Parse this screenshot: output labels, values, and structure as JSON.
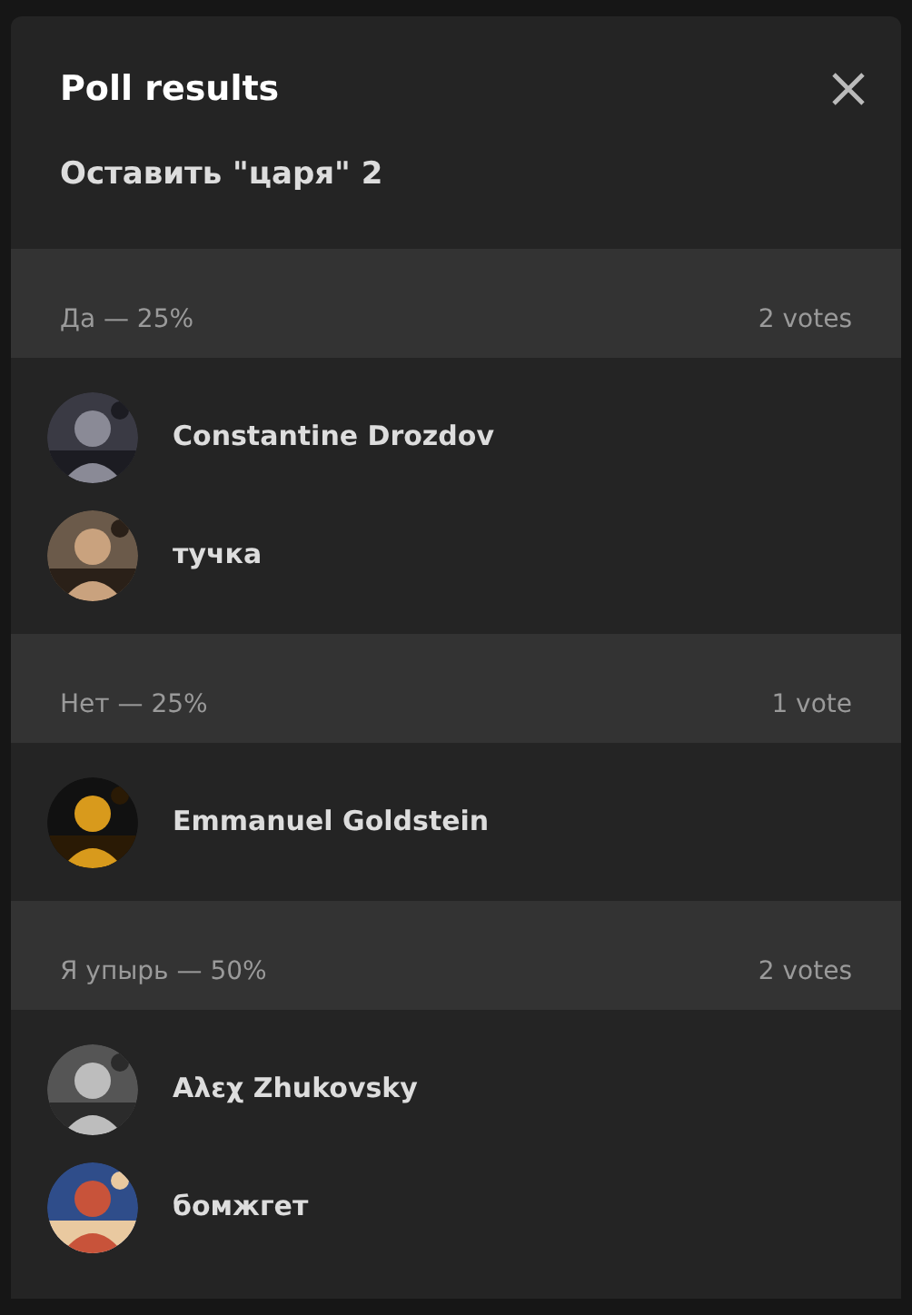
{
  "dialog": {
    "title": "Poll results",
    "question": "Оставить \"царя\" 2"
  },
  "options": [
    {
      "label": "Да — 25%",
      "count": "2 votes",
      "voters": [
        {
          "name": "Constantine Drozdov"
        },
        {
          "name": "тучка"
        }
      ]
    },
    {
      "label": "Нет — 25%",
      "count": "1 vote",
      "voters": [
        {
          "name": "Emmanuel Goldstein"
        }
      ]
    },
    {
      "label": "Я упырь — 50%",
      "count": "2 votes",
      "voters": [
        {
          "name": "Αλεχ Zhukovsky"
        },
        {
          "name": "бомжгет"
        }
      ]
    }
  ]
}
